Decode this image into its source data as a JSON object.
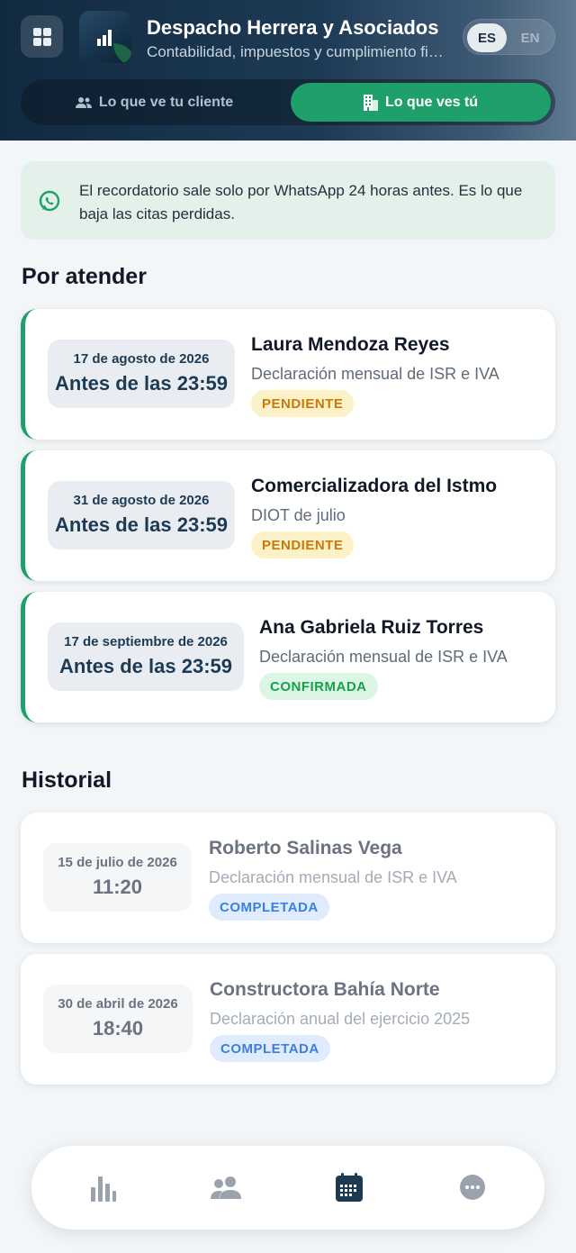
{
  "header": {
    "title": "Despacho Herrera y Asociados",
    "subtitle": "Contabilidad, impuestos y cumplimiento fiscal",
    "lang": {
      "es": "ES",
      "en": "EN",
      "selected": "ES"
    },
    "view_toggle": {
      "client_label": "Lo que ve tu cliente",
      "you_label": "Lo que ves tú",
      "selected": "you"
    }
  },
  "banner": {
    "text": "El recordatorio sale solo por WhatsApp 24 horas antes. Es lo que baja las citas perdidas."
  },
  "pending": {
    "title": "Por atender",
    "items": [
      {
        "date": "17 de agosto de 2026",
        "time": "Antes de las 23:59",
        "client": "Laura Mendoza Reyes",
        "service": "Declaración mensual de ISR e IVA",
        "status": "PENDIENTE"
      },
      {
        "date": "31 de agosto de 2026",
        "time": "Antes de las 23:59",
        "client": "Comercializadora del Istmo",
        "service": "DIOT de julio",
        "status": "PENDIENTE"
      },
      {
        "date": "17 de septiembre de 2026",
        "time": "Antes de las 23:59",
        "client": "Ana Gabriela Ruiz Torres",
        "service": "Declaración mensual de ISR e IVA",
        "status": "CONFIRMADA"
      }
    ]
  },
  "history": {
    "title": "Historial",
    "items": [
      {
        "date": "15 de julio de 2026",
        "time": "11:20",
        "client": "Roberto Salinas Vega",
        "service": "Declaración mensual de ISR e IVA",
        "status": "COMPLETADA"
      },
      {
        "date": "30 de abril de 2026",
        "time": "18:40",
        "client": "Constructora Bahía Norte",
        "service": "Declaración anual del ejercicio 2025",
        "status": "COMPLETADA"
      }
    ]
  },
  "bottom_nav": {
    "items": [
      "chart-icon",
      "users-icon",
      "calendar-icon",
      "more-icon"
    ],
    "active": "calendar-icon"
  },
  "colors": {
    "accent_green": "#1fa06b",
    "navy": "#1d3a55",
    "pending": "#c8790a",
    "confirmed": "#17a04e",
    "completed": "#3b7fe0"
  }
}
